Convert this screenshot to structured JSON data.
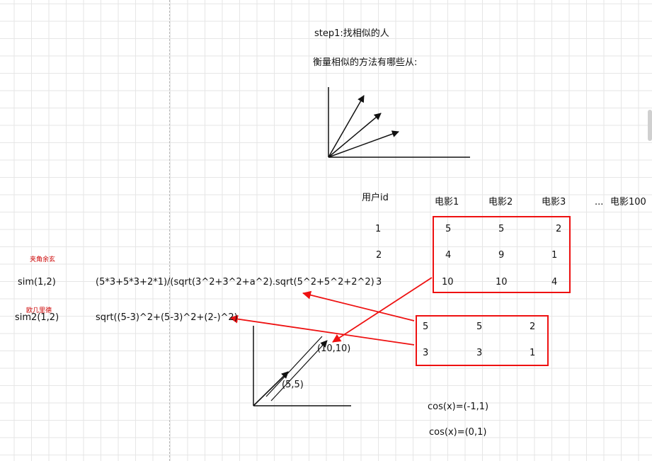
{
  "title": "step1:找相似的人",
  "subtitle": "衡量相似的方法有哪些从:",
  "table": {
    "user_header": "用户id",
    "movie_headers": [
      "电影1",
      "电影2",
      "电影3"
    ],
    "ellipsis": "...",
    "last_movie": "电影100",
    "user_ids": [
      "1",
      "2",
      "3"
    ],
    "rows": [
      [
        "5",
        "5",
        "2"
      ],
      [
        "4",
        "9",
        "1"
      ],
      [
        "10",
        "10",
        "4"
      ]
    ]
  },
  "box2": {
    "rows": [
      [
        "5",
        "5",
        "2"
      ],
      [
        "3",
        "3",
        "1"
      ]
    ]
  },
  "notes": {
    "cosine_tag": "夹角余玄",
    "sim_label": "sim(1,2)",
    "sim_formula": "(5*3+5*3+2*1)/(sqrt(3^2+3^2+a^2).sqrt(5^2+5^2+2^2)",
    "euclid_tag": "欧几里德",
    "sim2_label": "sim2(1,2)",
    "sim2_formula": "sqrt((5-3)^2+(5-3)^2+(2-)^2)"
  },
  "vectors": {
    "point_a": "(5,5)",
    "point_b": "(10,10)"
  },
  "cos_lines": [
    "cos(x)=(-1,1)",
    "cos(x)=(0,1)"
  ],
  "colors": {
    "accent": "#ee1111",
    "grid": "#e6e6e6",
    "ink": "#111111"
  }
}
